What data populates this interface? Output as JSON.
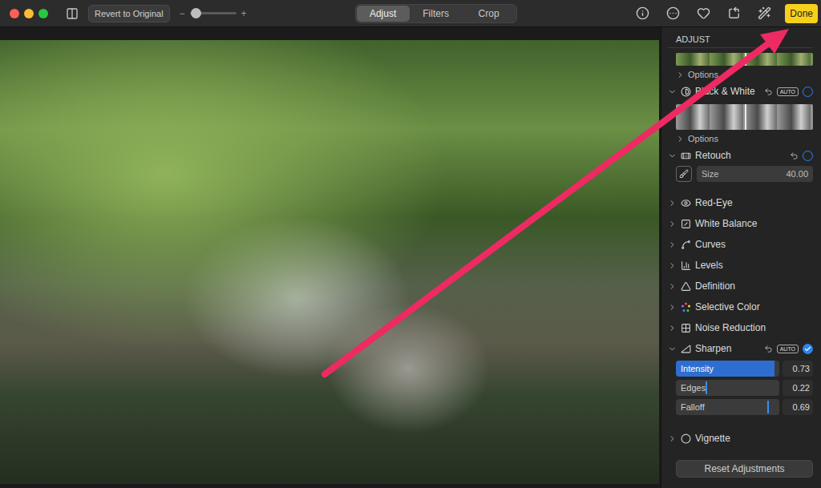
{
  "toolbar": {
    "revert_button": "Revert to Original",
    "zoom": {
      "minus": "−",
      "plus": "+",
      "level": 0.12
    },
    "tabs": [
      {
        "label": "Adjust",
        "selected": true
      },
      {
        "label": "Filters",
        "selected": false
      },
      {
        "label": "Crop",
        "selected": false
      }
    ],
    "done_button": "Done"
  },
  "sidebar": {
    "title": "ADJUST",
    "sections": [
      {
        "kind": "preview-tail",
        "options": "Options",
        "options_expanded": false
      },
      {
        "kind": "preview",
        "label": "Black & White",
        "expanded": true,
        "auto": "AUTO",
        "enabled": false,
        "options": "Options",
        "options_expanded": false
      },
      {
        "kind": "brush",
        "label": "Retouch",
        "expanded": true,
        "enabled": false,
        "size_label": "Size",
        "size": "40.00"
      },
      {
        "kind": "collapsed",
        "label": "Red-Eye",
        "expanded": false
      },
      {
        "kind": "collapsed",
        "label": "White Balance",
        "expanded": false
      },
      {
        "kind": "collapsed",
        "label": "Curves",
        "expanded": false
      },
      {
        "kind": "collapsed",
        "label": "Levels",
        "expanded": false
      },
      {
        "kind": "collapsed",
        "label": "Definition",
        "expanded": false
      },
      {
        "kind": "collapsed",
        "label": "Selective Color",
        "expanded": false
      },
      {
        "kind": "collapsed",
        "label": "Noise Reduction",
        "expanded": false
      },
      {
        "kind": "sliders",
        "label": "Sharpen",
        "expanded": true,
        "auto": "AUTO",
        "enabled": true,
        "sliders": [
          {
            "label": "Intensity",
            "value": "0.73",
            "level": 0.95,
            "highlighted": true
          },
          {
            "label": "Edges",
            "value": "0.22",
            "level": 0.29,
            "highlighted": false
          },
          {
            "label": "Falloff",
            "value": "0.69",
            "level": 0.88,
            "highlighted": false
          }
        ]
      },
      {
        "kind": "collapsed",
        "label": "Vignette",
        "expanded": false
      }
    ],
    "reset_button": "Reset Adjustments"
  }
}
